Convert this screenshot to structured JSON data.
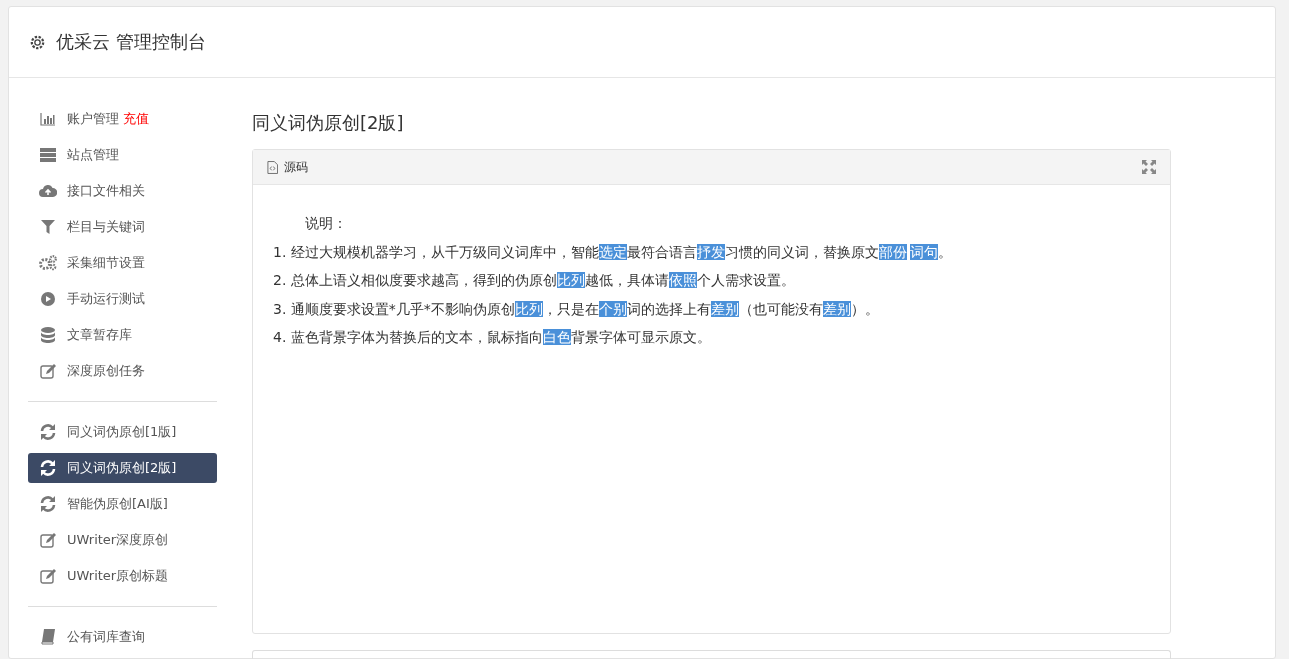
{
  "header": {
    "title": "优采云 管理控制台"
  },
  "sidebar": {
    "groups": [
      {
        "items": [
          {
            "label": "账户管理",
            "badge": "充值",
            "selected": false
          },
          {
            "label": "站点管理",
            "selected": false
          },
          {
            "label": "接口文件相关",
            "selected": false
          },
          {
            "label": "栏目与关键词",
            "selected": false
          },
          {
            "label": "采集细节设置",
            "selected": false
          },
          {
            "label": "手动运行测试",
            "selected": false
          },
          {
            "label": "文章暂存库",
            "selected": false
          },
          {
            "label": "深度原创任务",
            "selected": false
          }
        ]
      },
      {
        "items": [
          {
            "label": "同义词伪原创[1版]",
            "selected": false
          },
          {
            "label": "同义词伪原创[2版]",
            "selected": true
          },
          {
            "label": "智能伪原创[AI版]",
            "selected": false
          },
          {
            "label": "UWriter深度原创",
            "selected": false
          },
          {
            "label": "UWriter原创标题",
            "selected": false
          }
        ]
      },
      {
        "items": [
          {
            "label": "公有词库查询",
            "selected": false
          }
        ]
      }
    ]
  },
  "main": {
    "title": "同义词伪原创[2版]",
    "panel": {
      "title": "源码",
      "heading": "说明：",
      "lines": [
        [
          {
            "text": "1. 经过大规模机器学习，从千万级同义词库中，智能",
            "highlighted": false
          },
          {
            "text": "选定",
            "highlighted": true
          },
          {
            "text": "最符合语言",
            "highlighted": false
          },
          {
            "text": "抒发",
            "highlighted": true
          },
          {
            "text": "习惯的同义词，替换原文",
            "highlighted": false
          },
          {
            "text": "部份",
            "highlighted": true
          },
          {
            "text": "词句",
            "highlighted": true
          },
          {
            "text": "。",
            "highlighted": false
          }
        ],
        [
          {
            "text": "2. 总体上语义相似度要求越高，得到的伪原创",
            "highlighted": false
          },
          {
            "text": "比列",
            "highlighted": true
          },
          {
            "text": "越低，具体请",
            "highlighted": false
          },
          {
            "text": "依照",
            "highlighted": true
          },
          {
            "text": "个人需求设置。",
            "highlighted": false
          }
        ],
        [
          {
            "text": "3. 通顺度要求设置*几乎*不影响伪原创",
            "highlighted": false
          },
          {
            "text": "比列",
            "highlighted": true
          },
          {
            "text": "，只是在",
            "highlighted": false
          },
          {
            "text": "个别",
            "highlighted": true
          },
          {
            "text": "词的选择上有",
            "highlighted": false
          },
          {
            "text": "差别",
            "highlighted": true
          },
          {
            "text": "（也可能没有",
            "highlighted": false
          },
          {
            "text": "差别",
            "highlighted": true
          },
          {
            "text": "）。",
            "highlighted": false
          }
        ],
        [
          {
            "text": "4. 蓝色背景字体为替换后的文本，鼠标指向",
            "highlighted": false
          },
          {
            "text": "白色",
            "highlighted": true
          },
          {
            "text": "背景字体可显示原文。",
            "highlighted": false
          }
        ]
      ]
    }
  }
}
